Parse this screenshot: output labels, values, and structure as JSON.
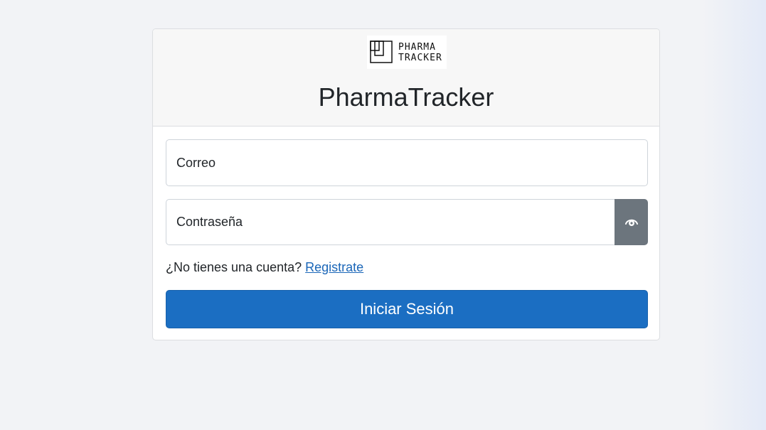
{
  "brand": {
    "logo_line1": "PHARMA",
    "logo_line2": "TRACKER",
    "title": "PharmaTracker"
  },
  "form": {
    "email_placeholder": "Correo",
    "password_placeholder": "Contraseña",
    "toggle_password_icon": "eye-icon",
    "register_prompt": "¿No tienes una cuenta?",
    "register_link": "Registrate",
    "submit_label": "Iniciar Sesión"
  },
  "colors": {
    "primary": "#1b6ec2",
    "toggle_button": "#6c757d",
    "link": "#1a66b8",
    "page_background": "#f2f3f6"
  }
}
